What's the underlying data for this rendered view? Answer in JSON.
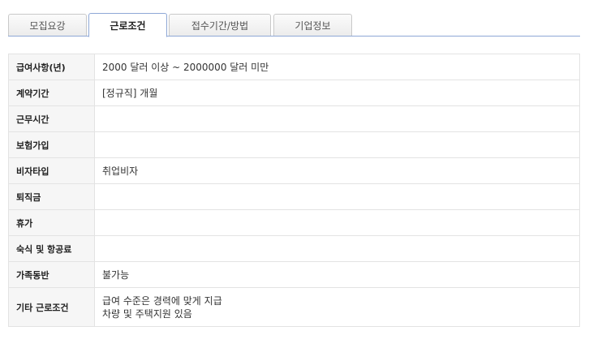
{
  "tabs": [
    {
      "label": "모집요강",
      "active": false
    },
    {
      "label": "근로조건",
      "active": true
    },
    {
      "label": "접수기간/방법",
      "active": false
    },
    {
      "label": "기업정보",
      "active": false
    }
  ],
  "rows": [
    {
      "label": "급여사항(년)",
      "value": "2000 달러 이상 ~ 2000000 달러 미만"
    },
    {
      "label": "계약기간",
      "value": "[정규직] 개월"
    },
    {
      "label": "근무시간",
      "value": ""
    },
    {
      "label": "보험가입",
      "value": ""
    },
    {
      "label": "비자타입",
      "value": "취업비자"
    },
    {
      "label": "퇴직금",
      "value": ""
    },
    {
      "label": "휴가",
      "value": ""
    },
    {
      "label": "숙식 및 항공료",
      "value": ""
    },
    {
      "label": "가족동반",
      "value": "불가능"
    },
    {
      "label": "기타 근로조건",
      "lines": [
        "급여 수준은 경력에 맞게 지급",
        "차량 및 주택지원 있음"
      ]
    }
  ]
}
